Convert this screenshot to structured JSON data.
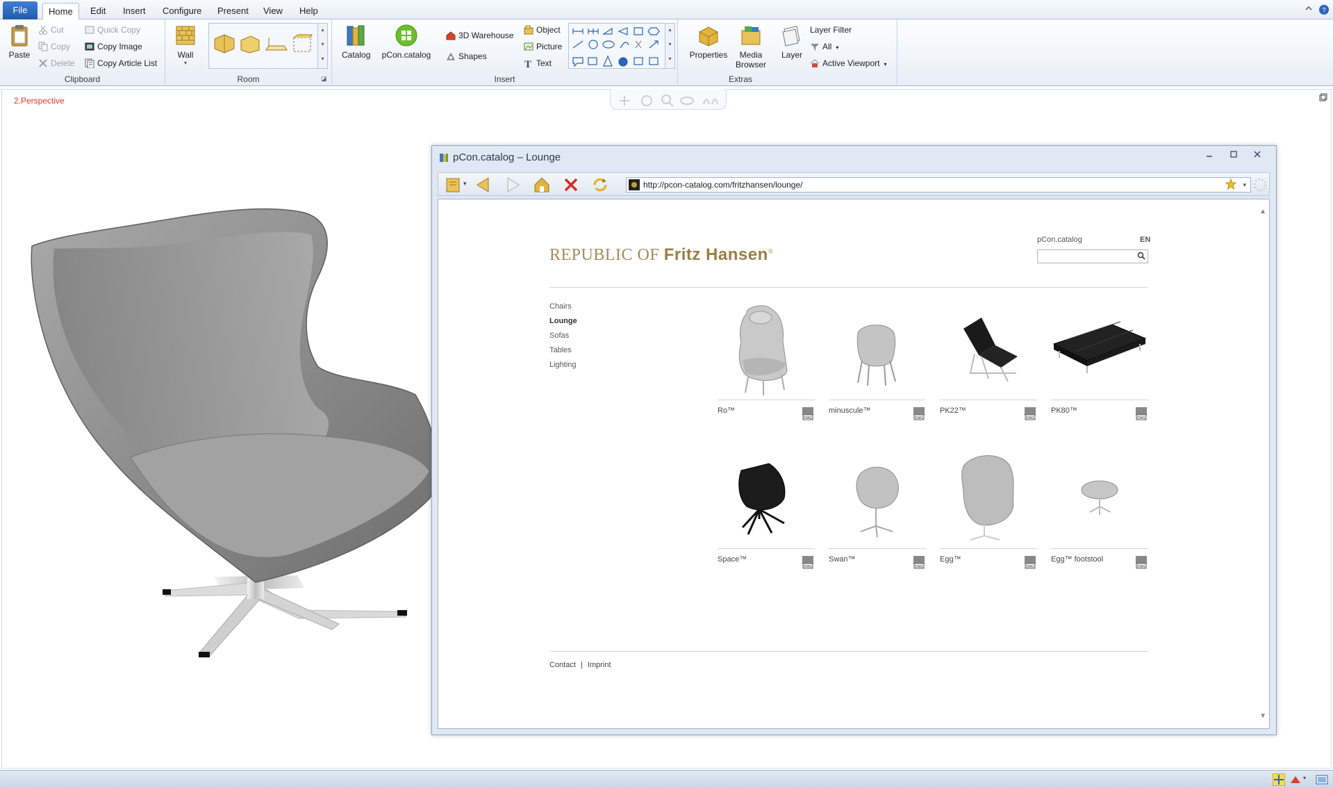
{
  "ribbon": {
    "file_tab": "File",
    "tabs": [
      "Home",
      "Edit",
      "Insert",
      "Configure",
      "Present",
      "View",
      "Help"
    ],
    "clipboard": {
      "paste": "Paste",
      "cut": "Cut",
      "copy": "Copy",
      "delete": "Delete",
      "quick_copy": "Quick Copy",
      "copy_image": "Copy Image",
      "copy_article_list": "Copy Article List",
      "label": "Clipboard"
    },
    "room": {
      "wall": "Wall",
      "label": "Room"
    },
    "insert": {
      "catalog": "Catalog",
      "pcon_catalog": "pCon.catalog",
      "warehouse": "3D Warehouse",
      "shapes": "Shapes",
      "object": "Object",
      "picture": "Picture",
      "text": "Text",
      "label": "Insert"
    },
    "extras": {
      "properties": "Properties",
      "media_browser_1": "Media",
      "media_browser_2": "Browser",
      "layer": "Layer",
      "layer_filter": "Layer Filter",
      "all": "All",
      "active_viewport": "Active Viewport",
      "label": "Extras"
    }
  },
  "viewport": {
    "label": "2.Perspective"
  },
  "catalog_window": {
    "title": "pCon.catalog – Lounge",
    "url": "http://pcon-catalog.com/fritzhansen/lounge/",
    "site": {
      "brand_light": "REPUBLIC OF ",
      "brand_bold": "Fritz Hansen",
      "brand_mark": "®",
      "search_label": "pCon.catalog",
      "lang": "EN",
      "categories": [
        {
          "label": "Chairs",
          "active": false
        },
        {
          "label": "Lounge",
          "active": true
        },
        {
          "label": "Sofas",
          "active": false
        },
        {
          "label": "Tables",
          "active": false
        },
        {
          "label": "Lighting",
          "active": false
        }
      ],
      "products": [
        {
          "name": "Ro™"
        },
        {
          "name": "minuscule™"
        },
        {
          "name": "PK22™"
        },
        {
          "name": "PK80™"
        },
        {
          "name": "Space™"
        },
        {
          "name": "Swan™"
        },
        {
          "name": "Egg™"
        },
        {
          "name": "Egg™ footstool"
        }
      ],
      "footer": {
        "contact": "Contact",
        "separator": "|",
        "imprint": "Imprint"
      },
      "dwg_badge": "DWG"
    }
  },
  "colors": {
    "accent": "#2b63b8",
    "brand_gold": "#a48b5a",
    "viewport_label": "#e0352e"
  }
}
